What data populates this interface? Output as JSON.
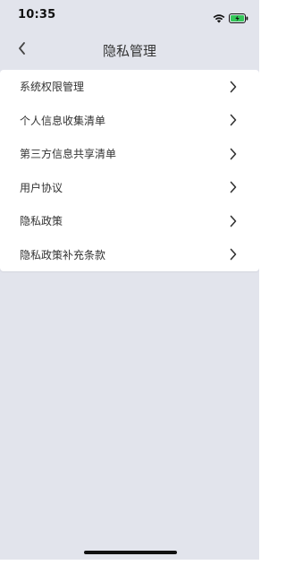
{
  "status_bar": {
    "time": "10:35",
    "wifi_icon": "wifi-icon",
    "battery_icon": "battery-charging-icon",
    "battery_color": "#34c759"
  },
  "nav": {
    "title": "隐私管理",
    "back_icon": "chevron-left-icon"
  },
  "menu": {
    "items": [
      {
        "label": "系统权限管理"
      },
      {
        "label": "个人信息收集清单"
      },
      {
        "label": "第三方信息共享清单"
      },
      {
        "label": "用户协议"
      },
      {
        "label": "隐私政策"
      },
      {
        "label": "隐私政策补充条款"
      }
    ],
    "chevron_icon": "chevron-right-icon"
  },
  "colors": {
    "background": "#e2e4ec",
    "card": "#ffffff",
    "text": "#333333"
  }
}
